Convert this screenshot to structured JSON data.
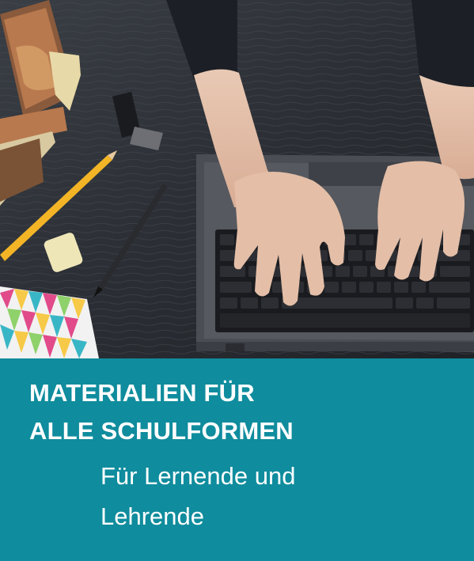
{
  "banner": {
    "headline_line1": "MATERIALIEN FÜR",
    "headline_line2": "ALLE SCHULFORMEN",
    "subline_line1": "Für Lernende und",
    "subline_line2": "Lehrende"
  },
  "colors": {
    "banner_bg": "#0f8c9d",
    "text": "#ffffff",
    "desk": "#2a2d33"
  }
}
